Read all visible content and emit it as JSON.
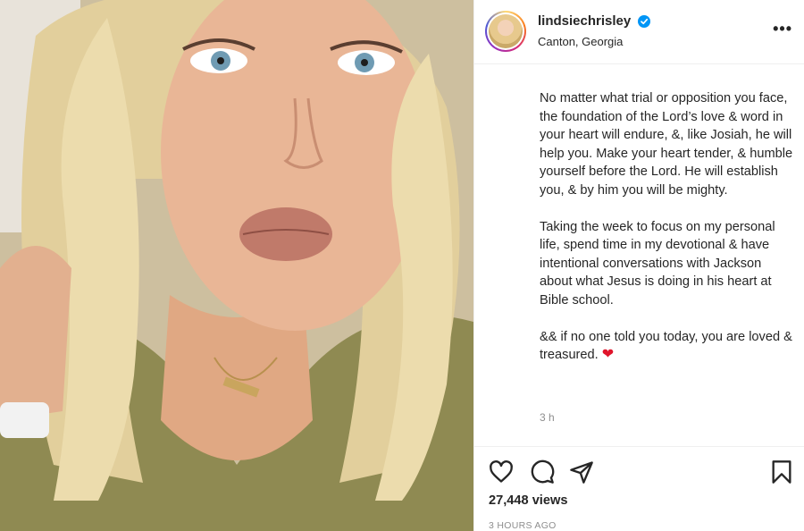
{
  "post": {
    "username": "lindsiechrisley",
    "location": "Canton, Georgia",
    "more_label": "•••",
    "caption_paragraphs": [
      "No matter what trial or opposition you face, the foundation of the Lord’s love & word in your heart will endure, &, like Josiah, he will help you. Make your heart tender, & humble yourself before the Lord. He will establish you, & by him you will be mighty.",
      "Taking the week to focus on my personal life, spend time in my devotional & have intentional conversations with Jackson about what Jesus is doing in his heart at Bible school.",
      "&& if no one told you today, you are loved & treasured."
    ],
    "heart_emoji": "❤",
    "caption_time": "3 h",
    "views": "27,448 views",
    "time_ago": "3 HOURS AGO"
  },
  "icons": {
    "verified": "verified-badge-icon",
    "like": "heart-icon",
    "comment": "comment-icon",
    "share": "share-icon",
    "save": "bookmark-icon"
  },
  "colors": {
    "verified_blue": "#0095f6",
    "heart_red": "#e0152b",
    "text": "#262626",
    "muted": "#8e8e8e"
  }
}
